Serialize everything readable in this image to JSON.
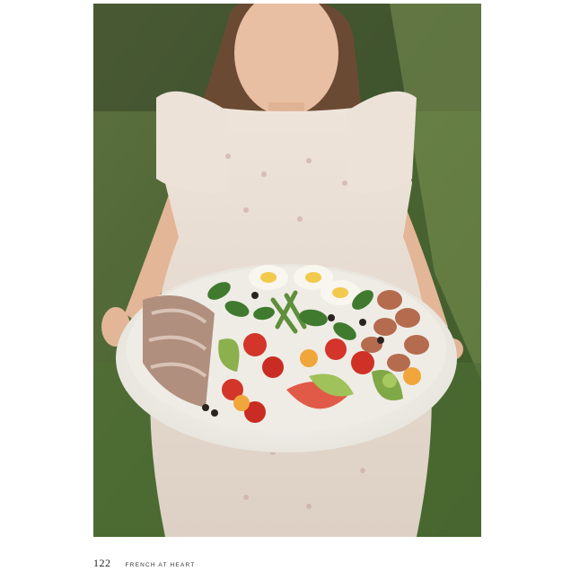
{
  "folio": {
    "page_number": "122",
    "running_head": "FRENCH AT HEART"
  },
  "photo": {
    "subject": "girl-holding-salad-platter",
    "colors": {
      "background_green": "#4f6b34",
      "dress": "#e9ddd2",
      "platter": "#f3f1ec",
      "tomato_red": "#d3352b",
      "basil_green": "#3f7a2e",
      "egg_yolk": "#f2c94c"
    }
  }
}
